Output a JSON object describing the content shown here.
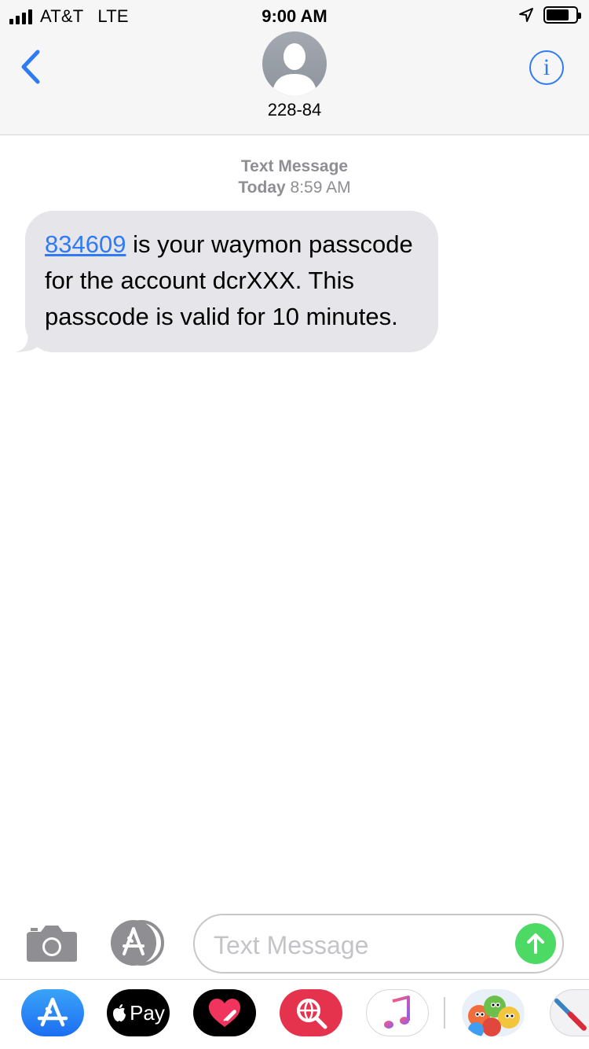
{
  "status_bar": {
    "carrier": "AT&T",
    "network": "LTE",
    "time": "9:00 AM",
    "signal_bars": 4,
    "battery_level": 0.65
  },
  "header": {
    "contact_name": "228-84",
    "back_icon": "chevron-left-icon",
    "info_icon": "info-icon",
    "avatar_icon": "person-silhouette-icon"
  },
  "conversation": {
    "service_label": "Text Message",
    "day_label": "Today",
    "time_label": "8:59 AM",
    "messages": [
      {
        "code": "834609",
        "text": " is your waymon passcode for the account dcrXXX. This passcode is valid for 10 minutes."
      }
    ]
  },
  "input_bar": {
    "placeholder": "Text Message",
    "value": "",
    "camera_icon": "camera-icon",
    "apps_icon": "app-store-icon",
    "send_icon": "arrow-up-icon"
  },
  "app_drawer": {
    "apple_pay_label": "Pay",
    "apps": [
      "app-store-icon",
      "apple-pay-icon",
      "digital-touch-heart-icon",
      "web-search-icon",
      "music-note-icon",
      "animoji-stickers-icon",
      "american-airlines-icon"
    ]
  },
  "colors": {
    "accent_blue": "#2f7bf5",
    "bubble_gray": "#e5e5ea",
    "send_green": "#4cd964",
    "meta_gray": "#8e8e93",
    "header_bg": "#f6f6f7"
  }
}
